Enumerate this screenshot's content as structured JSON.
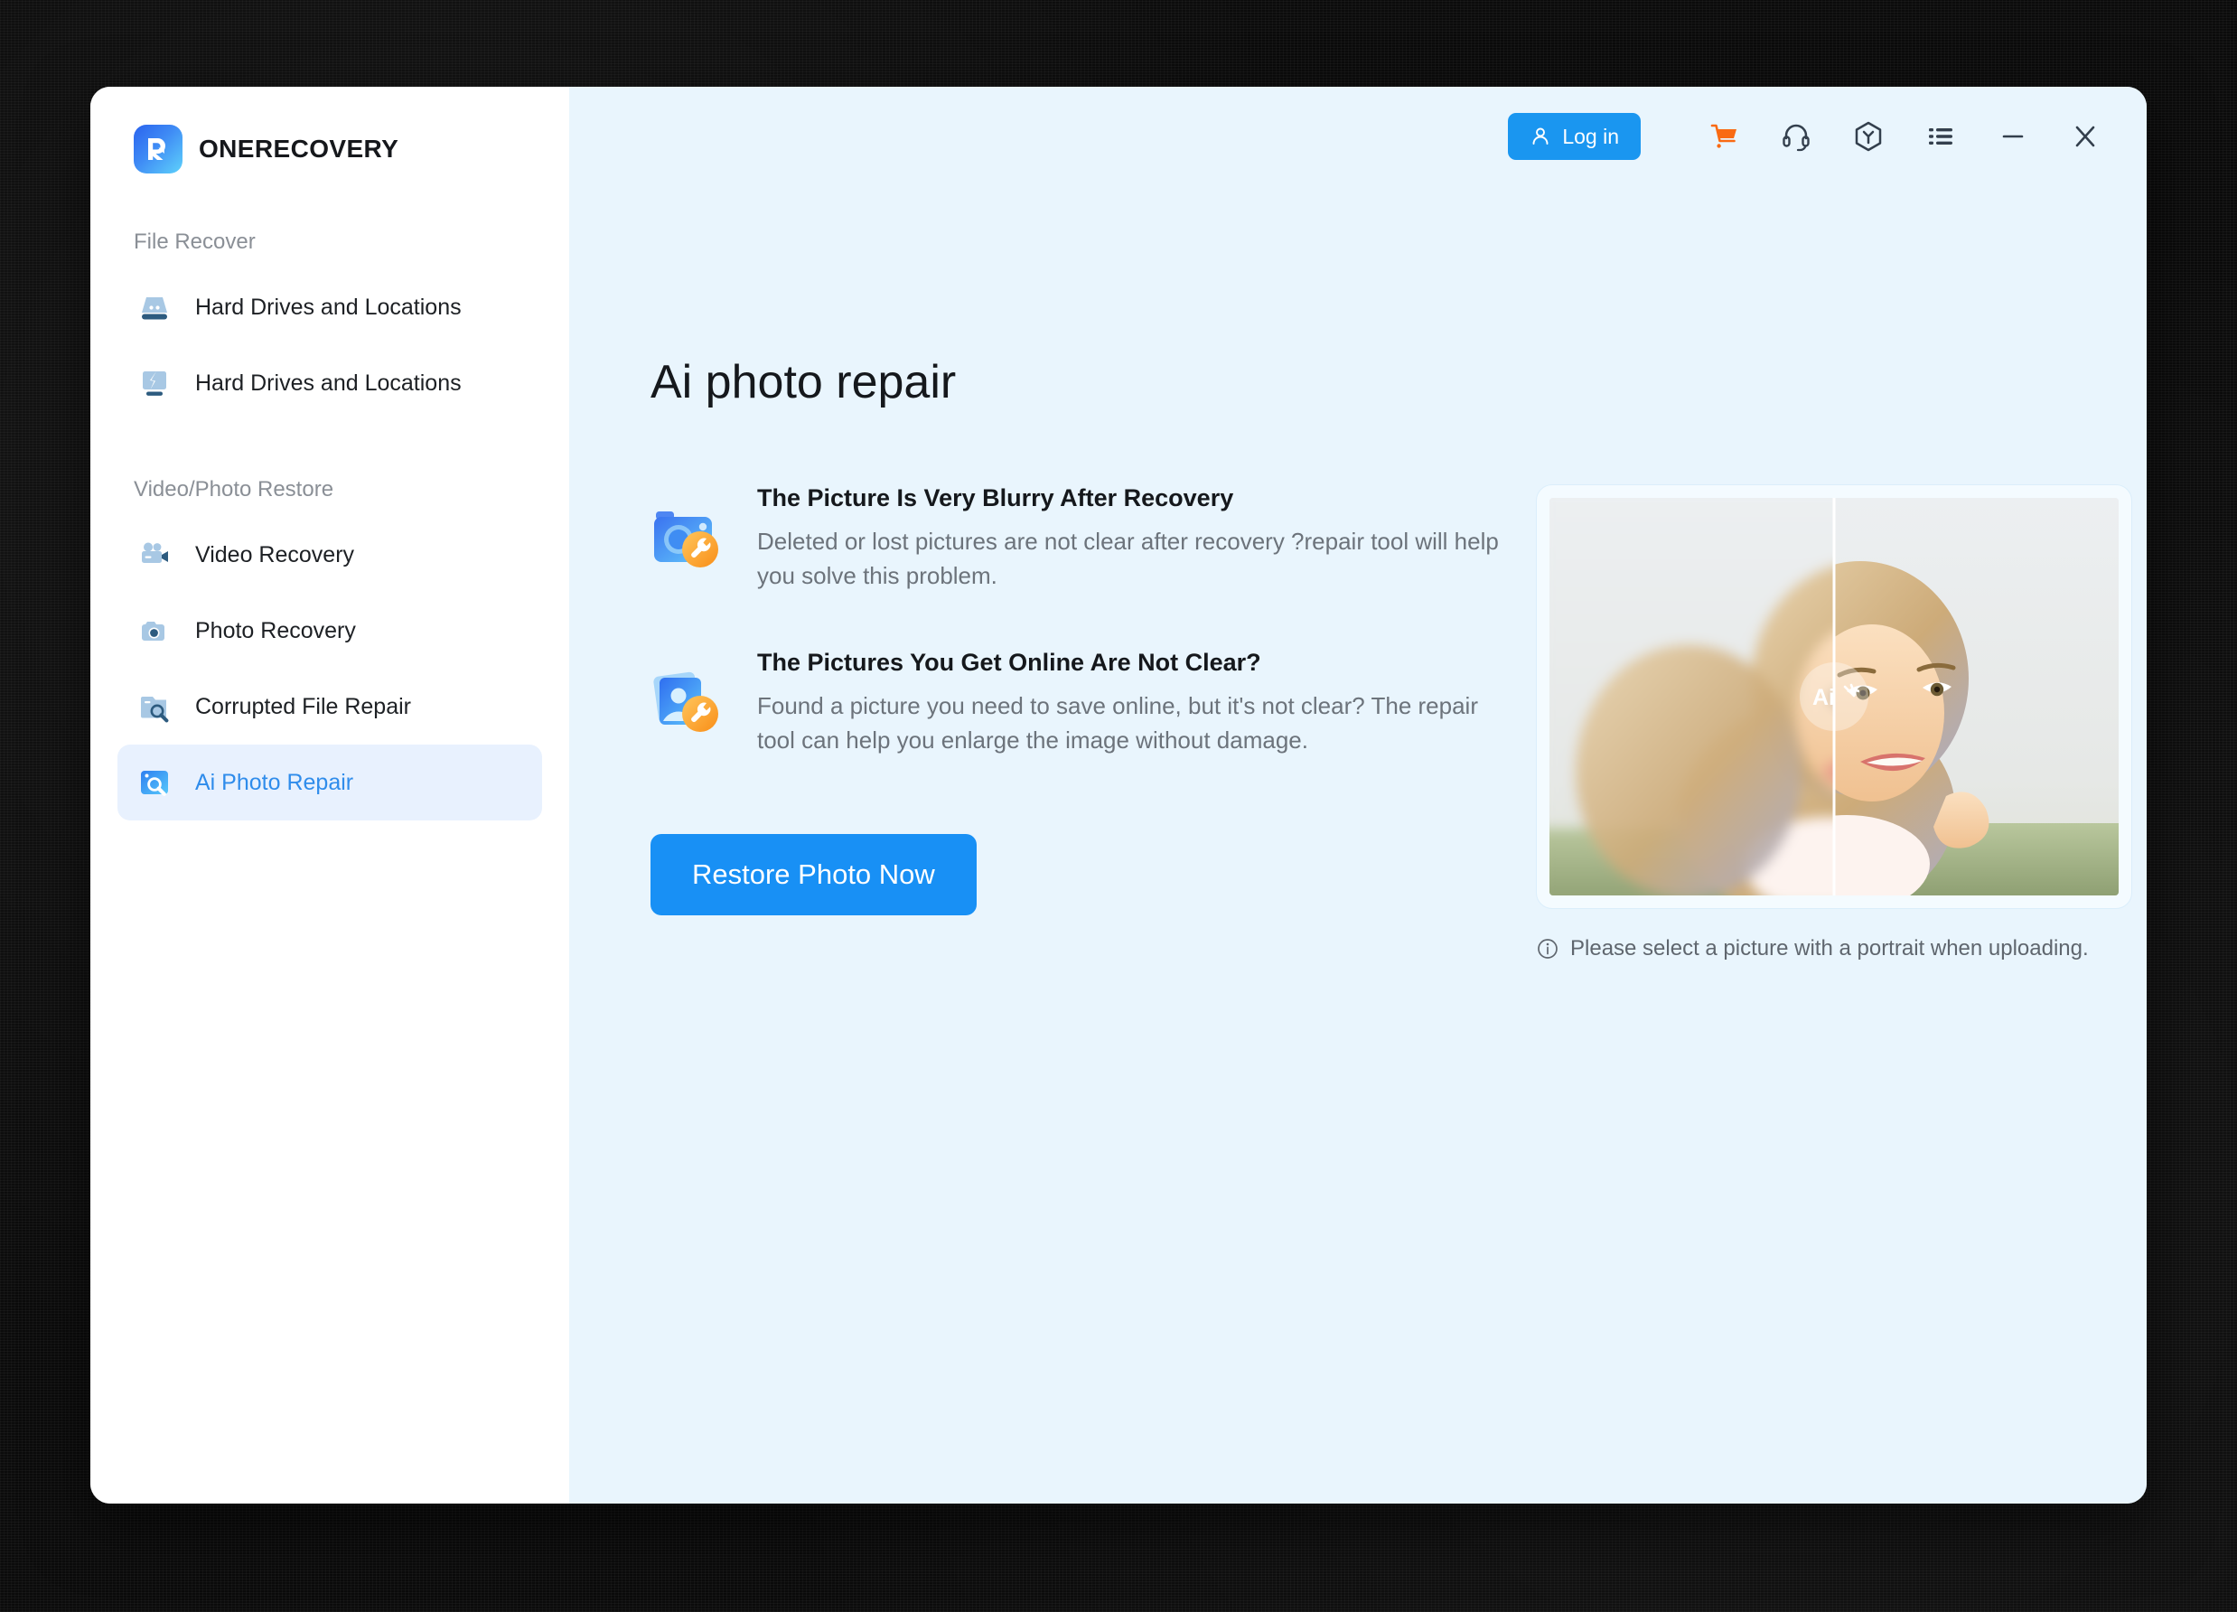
{
  "app": {
    "brand_name": "ONERECOVERY",
    "logo_icon": "onerecovery-logo-icon"
  },
  "titlebar": {
    "login_label": "Log in",
    "icons": [
      {
        "name": "cart-icon",
        "label": "Cart"
      },
      {
        "name": "headset-support-icon",
        "label": "Support"
      },
      {
        "name": "rewards-hexagon-icon",
        "label": "Rewards"
      },
      {
        "name": "menu-list-icon",
        "label": "Menu"
      },
      {
        "name": "minimize-icon",
        "label": "Minimize"
      },
      {
        "name": "close-icon",
        "label": "Close"
      }
    ]
  },
  "sidebar": {
    "sections": [
      {
        "title": "File Recover",
        "items": [
          {
            "label": "Hard Drives and Locations",
            "icon": "hard-drive-icon",
            "active": false
          },
          {
            "label": "Hard Drives and Locations",
            "icon": "broken-screen-icon",
            "active": false
          }
        ]
      },
      {
        "title": "Video/Photo Restore",
        "items": [
          {
            "label": "Video Recovery",
            "icon": "video-camera-icon",
            "active": false
          },
          {
            "label": "Photo Recovery",
            "icon": "camera-icon",
            "active": false
          },
          {
            "label": "Corrupted File Repair",
            "icon": "folder-wrench-icon",
            "active": false
          },
          {
            "label": "Ai Photo Repair",
            "icon": "ai-photo-repair-icon",
            "active": true
          }
        ]
      }
    ]
  },
  "main": {
    "page_title": "Ai photo repair",
    "features": [
      {
        "title": "The Picture Is Very Blurry After Recovery",
        "desc": "Deleted or lost pictures are not clear after recovery ?repair tool will help you solve this problem.",
        "icon": "camera-repair-icon"
      },
      {
        "title": "The Pictures You Get Online Are Not Clear?",
        "desc": "Found a picture you need to save online, but it's not clear? The repair tool can help you enlarge the image without damage.",
        "icon": "photo-portrait-repair-icon"
      }
    ],
    "cta_label": "Restore Photo Now",
    "preview": {
      "handle_label": "Ai",
      "note": "Please select a picture with a portrait when uploading.",
      "note_icon": "info-circle-icon"
    }
  },
  "colors": {
    "accent_blue": "#1890f5",
    "login_blue": "#1a96f0",
    "active_item_bg": "#e8f1fe",
    "active_item_text": "#2f8ceb",
    "content_bg": "#e9f5fd",
    "cart_orange": "#f96a13",
    "icon_slate": "#333f4d",
    "muted_text": "#6c737b"
  }
}
